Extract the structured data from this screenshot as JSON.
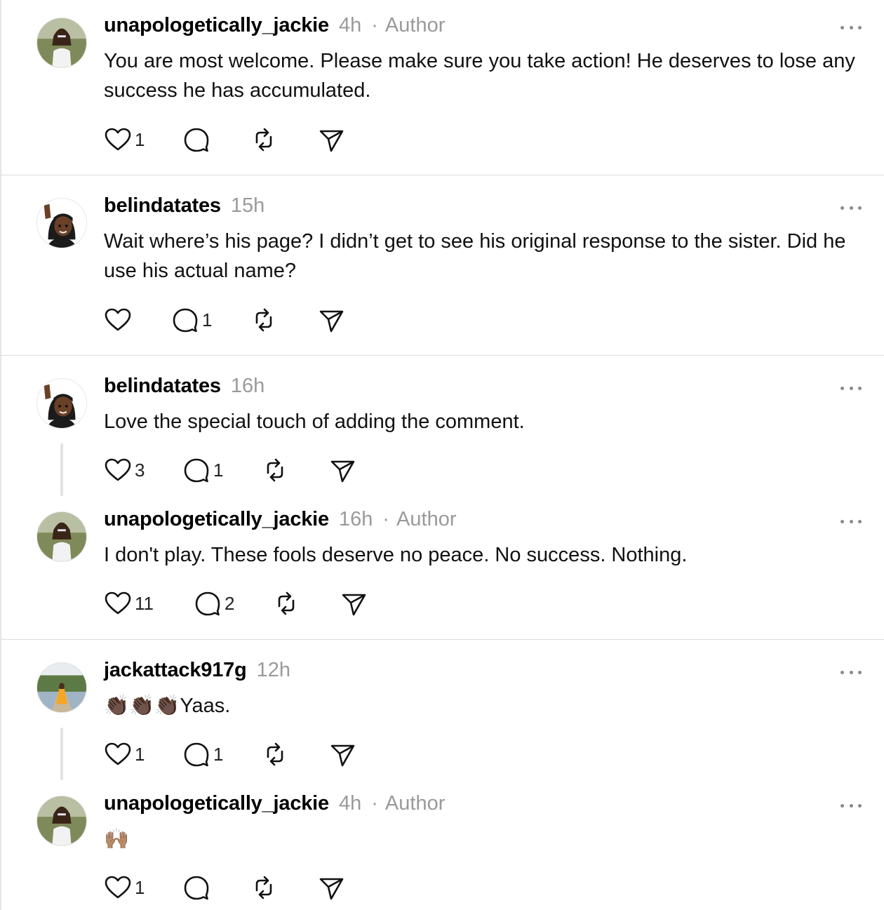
{
  "posts": [
    {
      "username": "unapologetically_jackie",
      "time": "4h",
      "author_label": "Author",
      "text": "You are most welcome. Please make sure you take action! He deserves to lose any success he has accumulated.",
      "likes": "1",
      "replies": ""
    },
    {
      "username": "belindatates",
      "time": "15h",
      "author_label": "",
      "text": "Wait where’s his page? I didn’t get to see his original response to the sister. Did he use his actual name?",
      "likes": "",
      "replies": "1"
    },
    {
      "username": "belindatates",
      "time": "16h",
      "author_label": "",
      "text": "Love the special touch of adding the comment.",
      "likes": "3",
      "replies": "1"
    },
    {
      "username": "unapologetically_jackie",
      "time": "16h",
      "author_label": "Author",
      "text": "I don't play. These fools deserve no peace. No success. Nothing.",
      "likes": "11",
      "replies": "2"
    },
    {
      "username": "jackattack917g",
      "time": "12h",
      "author_label": "",
      "text": "👏🏿👏🏿👏🏿Yaas.",
      "likes": "1",
      "replies": "1"
    },
    {
      "username": "unapologetically_jackie",
      "time": "4h",
      "author_label": "Author",
      "text": "🙌🏽",
      "likes": "1",
      "replies": ""
    }
  ],
  "author_separator": "·",
  "icons": {
    "like": "heart-icon",
    "reply": "comment-bubble-icon",
    "repost": "repost-icon",
    "share": "send-icon",
    "more": "more-dots-icon"
  },
  "colors": {
    "muted": "#9a9a9a",
    "divider": "#dcdcdc",
    "thread_line": "#e2e2e2"
  }
}
